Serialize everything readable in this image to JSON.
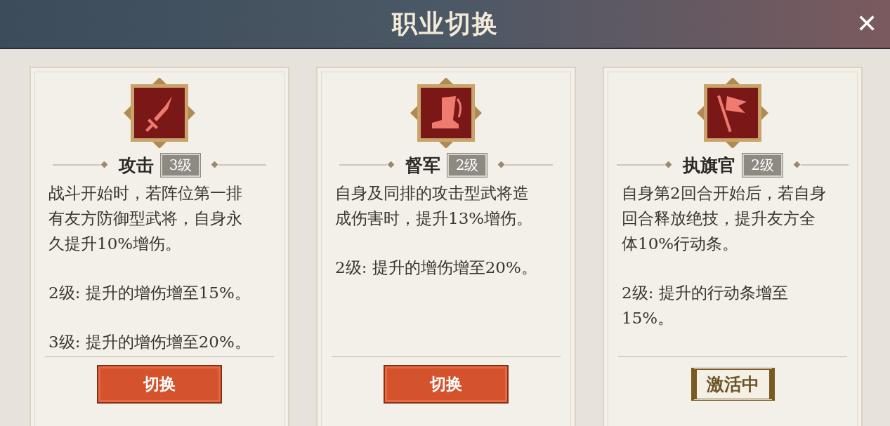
{
  "window": {
    "title": "职业切换",
    "close": "✕"
  },
  "cards": [
    {
      "name": "攻击",
      "level": "3级",
      "paragraphs": [
        "战斗开始时，若阵位第一排有友方防御型武将，自身永久提升10%增伤。",
        "2级: 提升的增伤增至15%。",
        "3级: 提升的增伤增至20%。"
      ],
      "action": {
        "kind": "switch",
        "label": "切换"
      }
    },
    {
      "name": "督军",
      "level": "2级",
      "paragraphs": [
        "自身及同排的攻击型武将造成伤害时，提升13%增伤。",
        "2级: 提升的增伤增至20%。"
      ],
      "action": {
        "kind": "switch",
        "label": "切换"
      }
    },
    {
      "name": "执旗官",
      "level": "2级",
      "paragraphs": [
        "自身第2回合开始后，若自身回合释放绝技，提升友方全体10%行动条。",
        "2级: 提升的行动条增至15%。"
      ],
      "action": {
        "kind": "active",
        "label": "激活中"
      }
    }
  ]
}
